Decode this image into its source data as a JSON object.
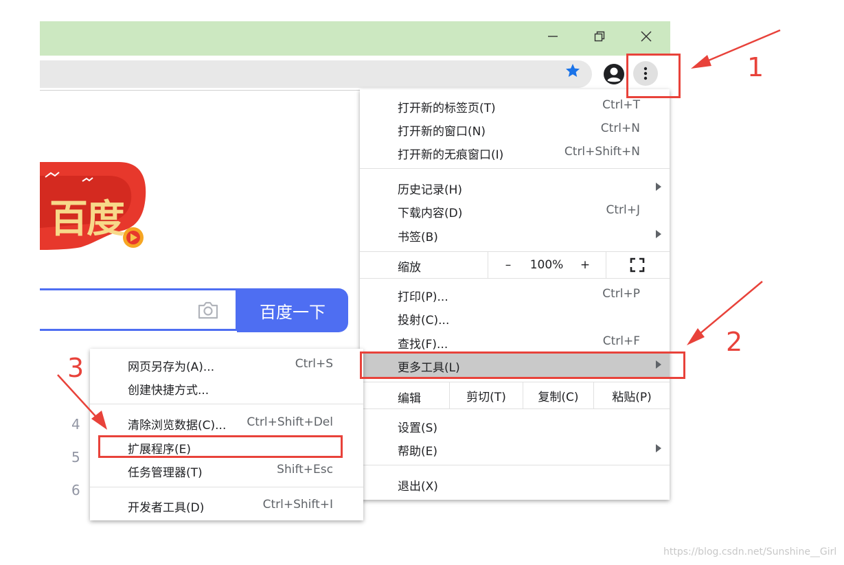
{
  "window": {
    "minimize_icon": "minimize-icon",
    "restore_icon": "restore-icon",
    "close_icon": "close-icon",
    "titlebar_color": "#cce8c1"
  },
  "toolbar": {
    "bookmark_icon": "star-icon",
    "profile_icon": "account-icon",
    "menu_icon": "kebab-menu-icon",
    "star_color": "#1a73e8"
  },
  "page": {
    "logo_text": "百度",
    "search_button": "百度一下",
    "camera_icon": "camera-icon",
    "side_numbers": [
      "4",
      "5",
      "6"
    ],
    "accent": "#4e6ef2"
  },
  "main_menu": {
    "new_tab": {
      "label": "打开新的标签页(T)",
      "shortcut": "Ctrl+T"
    },
    "new_window": {
      "label": "打开新的窗口(N)",
      "shortcut": "Ctrl+N"
    },
    "incognito": {
      "label": "打开新的无痕窗口(I)",
      "shortcut": "Ctrl+Shift+N"
    },
    "history": {
      "label": "历史记录(H)"
    },
    "downloads": {
      "label": "下载内容(D)",
      "shortcut": "Ctrl+J"
    },
    "bookmarks": {
      "label": "书签(B)"
    },
    "zoom": {
      "label": "缩放",
      "minus": "–",
      "value": "100%",
      "plus": "+"
    },
    "print": {
      "label": "打印(P)...",
      "shortcut": "Ctrl+P"
    },
    "cast": {
      "label": "投射(C)..."
    },
    "find": {
      "label": "查找(F)...",
      "shortcut": "Ctrl+F"
    },
    "more_tools": {
      "label": "更多工具(L)"
    },
    "edit": {
      "label": "编辑",
      "cut": "剪切(T)",
      "copy": "复制(C)",
      "paste": "粘贴(P)"
    },
    "settings": {
      "label": "设置(S)"
    },
    "help": {
      "label": "帮助(E)"
    },
    "exit": {
      "label": "退出(X)"
    }
  },
  "sub_menu": {
    "save_as": {
      "label": "网页另存为(A)...",
      "shortcut": "Ctrl+S"
    },
    "create_shortcut": {
      "label": "创建快捷方式..."
    },
    "clear_data": {
      "label": "清除浏览数据(C)...",
      "shortcut": "Ctrl+Shift+Del"
    },
    "extensions": {
      "label": "扩展程序(E)"
    },
    "task_manager": {
      "label": "任务管理器(T)",
      "shortcut": "Shift+Esc"
    },
    "devtools": {
      "label": "开发者工具(D)",
      "shortcut": "Ctrl+Shift+I"
    }
  },
  "annotations": {
    "step1": "1",
    "step2": "2",
    "step3": "3",
    "color": "#e8423a"
  },
  "watermark": "https://blog.csdn.net/Sunshine__Girl"
}
